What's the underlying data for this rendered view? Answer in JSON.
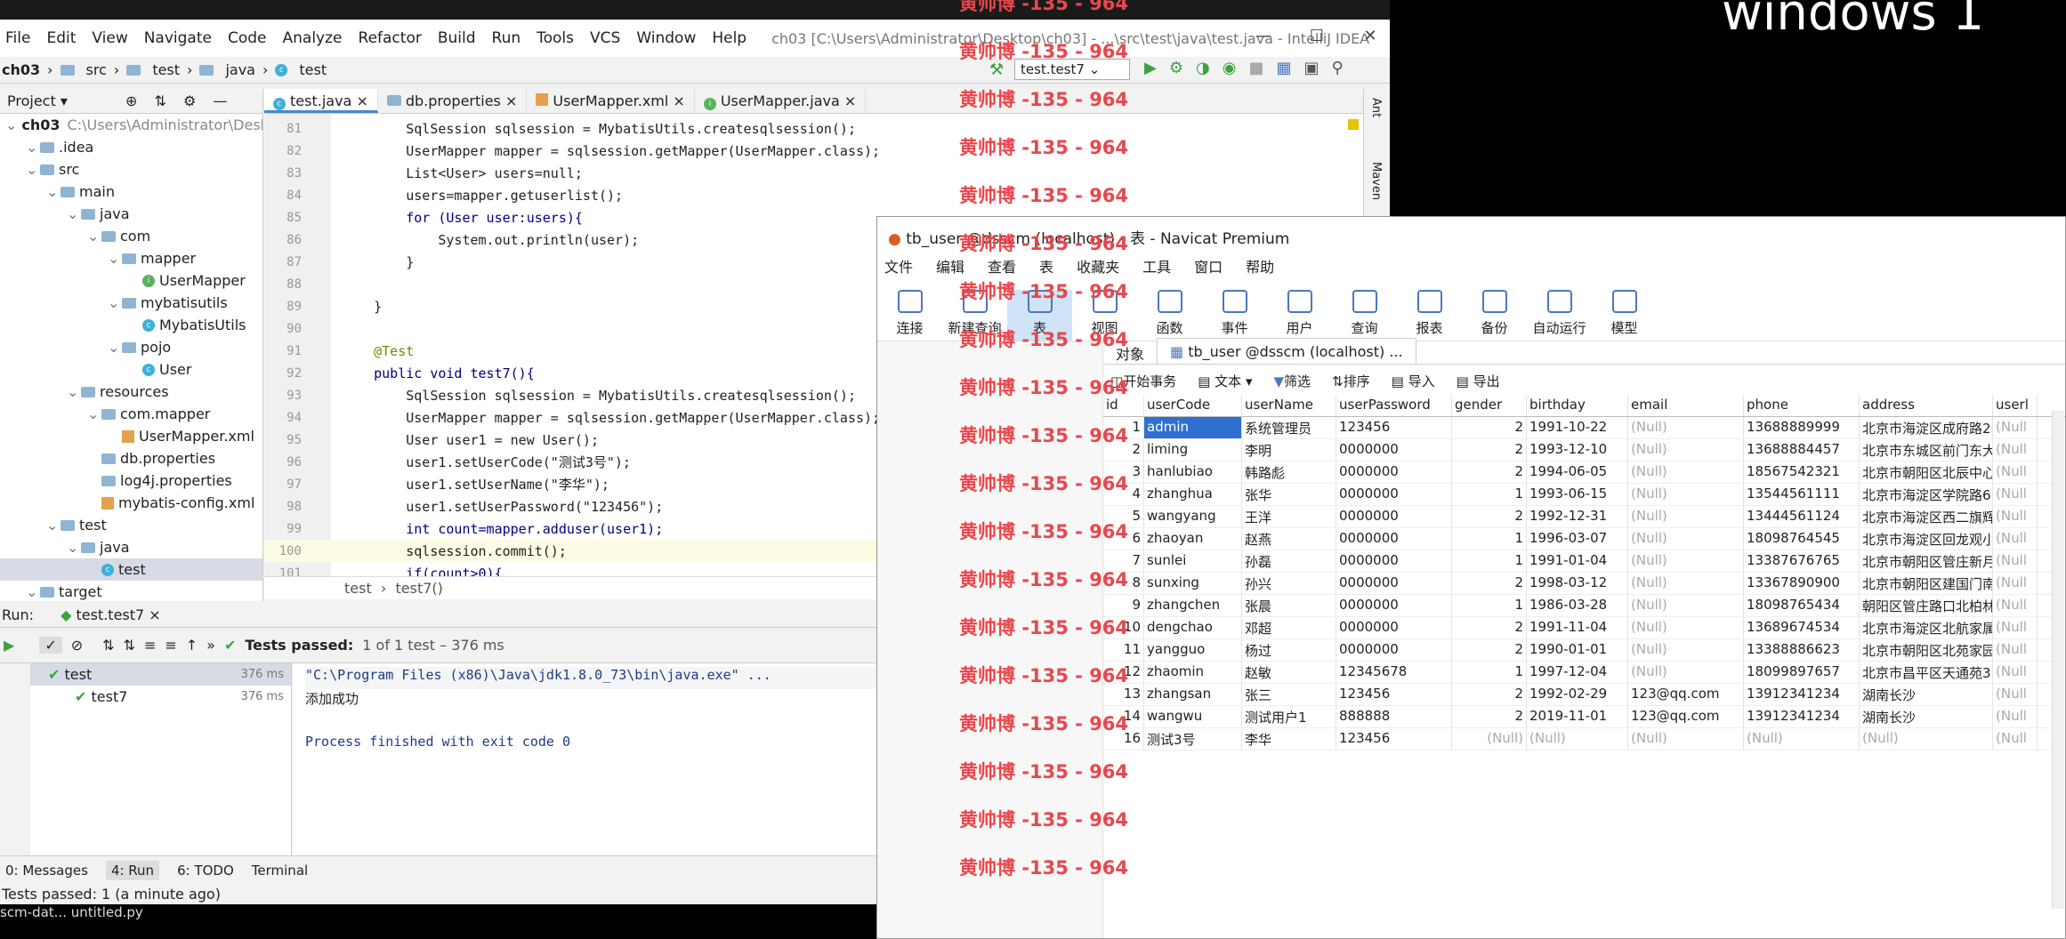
{
  "ide": {
    "menu": [
      "File",
      "Edit",
      "View",
      "Navigate",
      "Code",
      "Analyze",
      "Refactor",
      "Build",
      "Run",
      "Tools",
      "VCS",
      "Window",
      "Help"
    ],
    "title": "ch03 [C:\\Users\\Administrator\\Desktop\\ch03] - ...\\src\\test\\java\\test.java - IntelliJ IDEA",
    "breadcrumb": [
      "ch03",
      "src",
      "test",
      "java",
      "test"
    ],
    "run_config": "test.test7",
    "project_label": "Project",
    "tree": [
      {
        "label": "ch03",
        "extra": "C:\\Users\\Administrator\\Desk",
        "indent": 0,
        "icon": "folder"
      },
      {
        "label": ".idea",
        "indent": 1,
        "icon": "folder"
      },
      {
        "label": "src",
        "indent": 1,
        "icon": "folder"
      },
      {
        "label": "main",
        "indent": 2,
        "icon": "folder"
      },
      {
        "label": "java",
        "indent": 3,
        "icon": "folder"
      },
      {
        "label": "com",
        "indent": 4,
        "icon": "folder"
      },
      {
        "label": "mapper",
        "indent": 5,
        "icon": "folder"
      },
      {
        "label": "UserMapper",
        "indent": 6,
        "icon": "interface"
      },
      {
        "label": "mybatisutils",
        "indent": 5,
        "icon": "folder"
      },
      {
        "label": "MybatisUtils",
        "indent": 6,
        "icon": "class"
      },
      {
        "label": "pojo",
        "indent": 5,
        "icon": "folder"
      },
      {
        "label": "User",
        "indent": 6,
        "icon": "class"
      },
      {
        "label": "resources",
        "indent": 3,
        "icon": "folder"
      },
      {
        "label": "com.mapper",
        "indent": 4,
        "icon": "folder"
      },
      {
        "label": "UserMapper.xml",
        "indent": 5,
        "icon": "xml"
      },
      {
        "label": "db.properties",
        "indent": 4,
        "icon": "file"
      },
      {
        "label": "log4j.properties",
        "indent": 4,
        "icon": "file"
      },
      {
        "label": "mybatis-config.xml",
        "indent": 4,
        "icon": "xml"
      },
      {
        "label": "test",
        "indent": 2,
        "icon": "folder"
      },
      {
        "label": "java",
        "indent": 3,
        "icon": "folder"
      },
      {
        "label": "test",
        "indent": 4,
        "icon": "class",
        "selected": true
      },
      {
        "label": "target",
        "indent": 1,
        "icon": "folder"
      }
    ],
    "tabs": [
      "test.java",
      "db.properties",
      "UserMapper.xml",
      "UserMapper.java"
    ],
    "code": [
      {
        "n": "81",
        "t": "        SqlSession sqlsession = MybatisUtils.createsqlsession();"
      },
      {
        "n": "82",
        "t": "        UserMapper mapper = sqlsession.getMapper(UserMapper.class);"
      },
      {
        "n": "83",
        "t": "        List<User> users=null;"
      },
      {
        "n": "84",
        "t": "        users=mapper.getuserlist();"
      },
      {
        "n": "85",
        "t": "        for (User user:users){"
      },
      {
        "n": "86",
        "t": "            System.out.println(user);"
      },
      {
        "n": "87",
        "t": "        }"
      },
      {
        "n": "88",
        "t": ""
      },
      {
        "n": "89",
        "t": "    }"
      },
      {
        "n": "90",
        "t": ""
      },
      {
        "n": "91",
        "t": "    @Test"
      },
      {
        "n": "92",
        "t": "    public void test7(){"
      },
      {
        "n": "93",
        "t": "        SqlSession sqlsession = MybatisUtils.createsqlsession();"
      },
      {
        "n": "94",
        "t": "        UserMapper mapper = sqlsession.getMapper(UserMapper.class);"
      },
      {
        "n": "95",
        "t": "        User user1 = new User();"
      },
      {
        "n": "96",
        "t": "        user1.setUserCode(\"测试3号\");"
      },
      {
        "n": "97",
        "t": "        user1.setUserName(\"李华\");"
      },
      {
        "n": "98",
        "t": "        user1.setUserPassword(\"123456\");"
      },
      {
        "n": "99",
        "t": "        int count=mapper.adduser(user1);"
      },
      {
        "n": "100",
        "t": "        sqlsession.commit();"
      },
      {
        "n": "101",
        "t": "        if(count>0){"
      }
    ],
    "editor_crumb": [
      "test",
      "test7()"
    ],
    "run_label": "Run:",
    "run_tab": "test.test7",
    "tests_passed": "Tests passed:",
    "tests_detail": "1 of 1 test – 376 ms",
    "run_tree": [
      {
        "label": "test",
        "time": "376 ms"
      },
      {
        "label": "test7",
        "time": "376 ms"
      }
    ],
    "console": [
      "\"C:\\Program Files (x86)\\Java\\jdk1.8.0_73\\bin\\java.exe\" ...",
      "添加成功",
      "",
      "Process finished with exit code 0"
    ],
    "bottom_tabs": [
      "0: Messages",
      "4: Run",
      "6: TODO",
      "Terminal"
    ],
    "status": "Tests passed: 1 (a minute ago)",
    "side_right": [
      "Ant",
      "Maven"
    ]
  },
  "navicat": {
    "title": "tb_user @dsscm (localhost) - 表 - Navicat Premium",
    "menu": [
      "文件",
      "编辑",
      "查看",
      "表",
      "收藏夹",
      "工具",
      "窗口",
      "帮助"
    ],
    "tools": [
      "连接",
      "新建查询",
      "表",
      "视图",
      "函数",
      "事件",
      "用户",
      "查询",
      "报表",
      "备份",
      "自动运行",
      "模型"
    ],
    "tabs": [
      "对象",
      "tb_user @dsscm (localhost) ..."
    ],
    "sub": [
      "开始事务",
      "文本",
      "筛选",
      "排序",
      "导入",
      "导出"
    ],
    "columns": [
      "id",
      "userCode",
      "userName",
      "userPassword",
      "gender",
      "birthday",
      "email",
      "phone",
      "address",
      "userl"
    ],
    "rows": [
      [
        "1",
        "admin",
        "系统管理员",
        "123456",
        "2",
        "1991-10-22",
        "(Null)",
        "13688889999",
        "北京市海淀区成府路2(",
        "(Null"
      ],
      [
        "2",
        "liming",
        "李明",
        "0000000",
        "2",
        "1993-12-10",
        "(Null)",
        "13688884457",
        "北京市东城区前门东大",
        "(Null"
      ],
      [
        "3",
        "hanlubiao",
        "韩路彪",
        "0000000",
        "2",
        "1994-06-05",
        "(Null)",
        "18567542321",
        "北京市朝阳区北辰中心",
        "(Null"
      ],
      [
        "4",
        "zhanghua",
        "张华",
        "0000000",
        "1",
        "1993-06-15",
        "(Null)",
        "13544561111",
        "北京市海淀区学院路6",
        "(Null"
      ],
      [
        "5",
        "wangyang",
        "王洋",
        "0000000",
        "2",
        "1992-12-31",
        "(Null)",
        "13444561124",
        "北京市海淀区西二旗辉",
        "(Null"
      ],
      [
        "6",
        "zhaoyan",
        "赵燕",
        "0000000",
        "1",
        "1996-03-07",
        "(Null)",
        "18098764545",
        "北京市海淀区回龙观小",
        "(Null"
      ],
      [
        "7",
        "sunlei",
        "孙磊",
        "0000000",
        "1",
        "1991-01-04",
        "(Null)",
        "13387676765",
        "北京市朝阳区管庄新月",
        "(Null"
      ],
      [
        "8",
        "sunxing",
        "孙兴",
        "0000000",
        "2",
        "1998-03-12",
        "(Null)",
        "13367890900",
        "北京市朝阳区建国门南",
        "(Null"
      ],
      [
        "9",
        "zhangchen",
        "张晨",
        "0000000",
        "1",
        "1986-03-28",
        "(Null)",
        "18098765434",
        "朝阳区管庄路口北柏林",
        "(Null"
      ],
      [
        "10",
        "dengchao",
        "邓超",
        "0000000",
        "2",
        "1991-11-04",
        "(Null)",
        "13689674534",
        "北京市海淀区北航家属",
        "(Null"
      ],
      [
        "11",
        "yangguo",
        "杨过",
        "0000000",
        "2",
        "1990-01-01",
        "(Null)",
        "13388886623",
        "北京市朝阳区北苑家园",
        "(Null"
      ],
      [
        "12",
        "zhaomin",
        "赵敏",
        "12345678",
        "1",
        "1997-12-04",
        "(Null)",
        "18099897657",
        "北京市昌平区天通苑3",
        "(Null"
      ],
      [
        "13",
        "zhangsan",
        "张三",
        "123456",
        "2",
        "1992-02-29",
        "123@qq.com",
        "13912341234",
        "湖南长沙",
        "(Null"
      ],
      [
        "14",
        "wangwu",
        "测试用户1",
        "888888",
        "2",
        "2019-11-01",
        "123@qq.com",
        "13912341234",
        "湖南长沙",
        "(Null"
      ],
      [
        "16",
        "测试3号",
        "李华",
        "123456",
        "(Null)",
        "(Null)",
        "(Null)",
        "(Null)",
        "(Null)",
        "(Null"
      ]
    ]
  },
  "watermark": "黄帅博 -135 - 964",
  "top_right_text": "windows 1",
  "taskbar_text": "scm-dat... untitled.py"
}
